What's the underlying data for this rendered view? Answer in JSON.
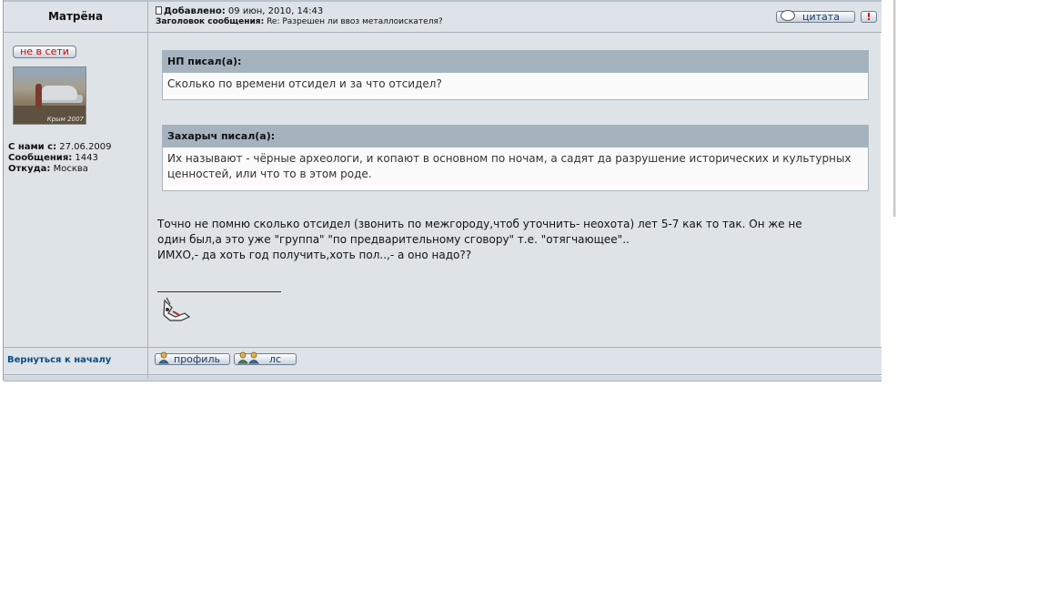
{
  "author": {
    "name": "Матрёна",
    "status": "не в сети",
    "avatar_caption": "Крым 2007",
    "joined_label": "С нами с:",
    "joined_value": "27.06.2009",
    "posts_label": "Сообщения:",
    "posts_value": "1443",
    "from_label": "Откуда:",
    "from_value": "Москва"
  },
  "post": {
    "added_label": "Добавлено:",
    "added_value": "09 июн, 2010, 14:43",
    "subject_label": "Заголовок сообщения:",
    "subject_value": "Re: Разрешен ли ввоз металлоискателя?",
    "quote_button": "цитата",
    "report_button": "!"
  },
  "quotes": [
    {
      "header": "НП писал(а):",
      "text": "Сколько по времени отсидел и за что отсидел?"
    },
    {
      "header": "Захарыч писал(а):",
      "text": "Их называют - чёрные археологи, и копают в основном по ночам, а садят да разрушение исторических и культурных ценностей, или что то в этом роде."
    }
  ],
  "message_lines": [
    "Точно не помню сколько отсидел (звонить по межгороду,чтоб уточнить- неохота) лет 5-7 как то так. Он же не",
    "один был,а это уже \"группа\" \"по предварительному сговору\" т.е. \"отягчающее\"..",
    "ИМХО,- да хоть год получить,хоть пол..,- а оно надо??"
  ],
  "footer": {
    "back_to_top": "Вернуться к началу",
    "profile_button": "профиль",
    "pm_button": "лс"
  },
  "icons": {
    "post": "post-icon",
    "quote": "speech-bubble-icon",
    "profile": "user-icon",
    "pm": "users-icon",
    "signature": "signature-image"
  },
  "colors": {
    "panel_bg": "#dee3e7",
    "quote_header_bg": "#a5b3bf",
    "offline_text": "#d40000",
    "link": "#0b4b82"
  }
}
